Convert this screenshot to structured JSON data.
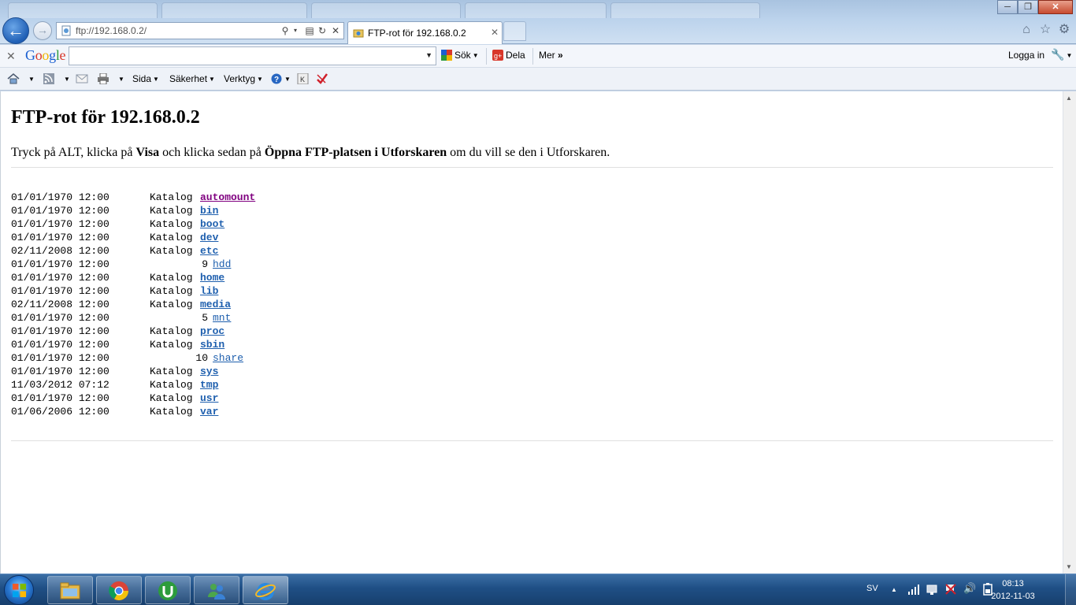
{
  "browser": {
    "address": "ftp://192.168.0.2/",
    "tab_title": "FTP-rot för 192.168.0.2",
    "tab_close": "✕",
    "back_icon": "back-arrow-icon",
    "forward_icon": "forward-arrow-icon"
  },
  "google_toolbar": {
    "logo_letters": [
      "G",
      "o",
      "o",
      "g",
      "l",
      "e"
    ],
    "logo_colors": [
      "#1a5fd1",
      "#d8372a",
      "#f0b400",
      "#1a5fd1",
      "#2a9a3c",
      "#d8372a"
    ],
    "search_value": "",
    "search_label": "Sök",
    "share_label": "Dela",
    "more_label": "Mer",
    "login_label": "Logga in"
  },
  "command_bar": {
    "page_label": "Sida",
    "security_label": "Säkerhet",
    "tools_label": "Verktyg"
  },
  "page": {
    "title": "FTP-rot för 192.168.0.2",
    "instr_1": "Tryck på ALT, klicka på ",
    "instr_bold_1": "Visa",
    "instr_2": " och klicka sedan på ",
    "instr_bold_2": "Öppna FTP-platsen i Utforskaren",
    "instr_3": " om du vill se den i Utforskaren."
  },
  "listing": [
    {
      "date": "01/01/1970 12:00",
      "kind": "Katalog",
      "size": "",
      "name": "automount",
      "visited": true
    },
    {
      "date": "01/01/1970 12:00",
      "kind": "Katalog",
      "size": "",
      "name": "bin"
    },
    {
      "date": "01/01/1970 12:00",
      "kind": "Katalog",
      "size": "",
      "name": "boot"
    },
    {
      "date": "01/01/1970 12:00",
      "kind": "Katalog",
      "size": "",
      "name": "dev"
    },
    {
      "date": "02/11/2008 12:00",
      "kind": "Katalog",
      "size": "",
      "name": "etc"
    },
    {
      "date": "01/01/1970 12:00",
      "kind": "",
      "size": "9",
      "name": "hdd"
    },
    {
      "date": "01/01/1970 12:00",
      "kind": "Katalog",
      "size": "",
      "name": "home"
    },
    {
      "date": "01/01/1970 12:00",
      "kind": "Katalog",
      "size": "",
      "name": "lib"
    },
    {
      "date": "02/11/2008 12:00",
      "kind": "Katalog",
      "size": "",
      "name": "media"
    },
    {
      "date": "01/01/1970 12:00",
      "kind": "",
      "size": "5",
      "name": "mnt"
    },
    {
      "date": "01/01/1970 12:00",
      "kind": "Katalog",
      "size": "",
      "name": "proc"
    },
    {
      "date": "01/01/1970 12:00",
      "kind": "Katalog",
      "size": "",
      "name": "sbin"
    },
    {
      "date": "01/01/1970 12:00",
      "kind": "",
      "size": "10",
      "name": "share"
    },
    {
      "date": "01/01/1970 12:00",
      "kind": "Katalog",
      "size": "",
      "name": "sys"
    },
    {
      "date": "11/03/2012 07:12",
      "kind": "Katalog",
      "size": "",
      "name": "tmp"
    },
    {
      "date": "01/01/1970 12:00",
      "kind": "Katalog",
      "size": "",
      "name": "usr"
    },
    {
      "date": "01/06/2006 12:00",
      "kind": "Katalog",
      "size": "",
      "name": "var"
    }
  ],
  "taskbar": {
    "apps": [
      "explorer-icon",
      "chrome-icon",
      "utorrent-icon",
      "messenger-icon",
      "internet-explorer-icon"
    ],
    "language": "SV",
    "time": "08:13",
    "date": "2012-11-03"
  }
}
